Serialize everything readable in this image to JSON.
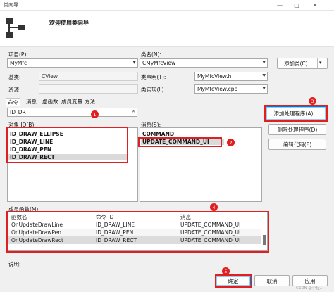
{
  "window": {
    "title": "类向导",
    "controls": [
      "—",
      "□",
      "✕"
    ]
  },
  "header": {
    "welcome": "欢迎使用类向导"
  },
  "project": {
    "label": "项目(P):",
    "value": "MyMfc"
  },
  "class_name": {
    "label": "类名(N):",
    "value": "CMyMfcView"
  },
  "add_class": {
    "label": "添加类(C)...",
    "arrow": "▾"
  },
  "base_class": {
    "label": "基类:",
    "value": "CView"
  },
  "class_decl": {
    "label": "类声明(T):",
    "value": "MyMfcView.h"
  },
  "resource": {
    "label": "资源:"
  },
  "class_impl": {
    "label": "类实现(L):",
    "value": "MyMfcView.cpp"
  },
  "tabs": [
    "命令",
    "消息",
    "虚函数",
    "成员变量",
    "方法"
  ],
  "search": {
    "value": "ID_DR",
    "icon": "✕"
  },
  "object_ids": {
    "label": "对象 ID(B):",
    "items": [
      "ID_DRAW_ELLIPSE",
      "ID_DRAW_LINE",
      "ID_DRAW_PEN",
      "ID_DRAW_RECT"
    ]
  },
  "messages": {
    "label": "消息(S):",
    "items": [
      "COMMAND",
      "UPDATE_COMMAND_UI"
    ]
  },
  "buttons": {
    "add_handler": "添加处理程序(A)...",
    "delete_handler": "删除处理程序(D)",
    "edit_code": "编辑代码(E)",
    "ok": "确定",
    "cancel": "取消",
    "apply": "应用"
  },
  "member_functions": {
    "label": "成员函数(M):",
    "columns": [
      "函数名",
      "命令 ID",
      "消息"
    ],
    "rows": [
      [
        "OnUpdateDrawLine",
        "ID_DRAW_LINE",
        "UPDATE_COMMAND_UI"
      ],
      [
        "OnUpdateDrawPen",
        "ID_DRAW_PEN",
        "UPDATE_COMMAND_UI"
      ],
      [
        "OnUpdateDrawRect",
        "ID_DRAW_RECT",
        "UPDATE_COMMAND_UI"
      ]
    ]
  },
  "description": {
    "label": "说明:"
  },
  "badges": [
    "1",
    "2",
    "3",
    "4",
    "5"
  ],
  "watermark": "CSDN @小伍...",
  "colors": {
    "annotation_red": "#e02020",
    "focus_blue": "#0078d7"
  }
}
